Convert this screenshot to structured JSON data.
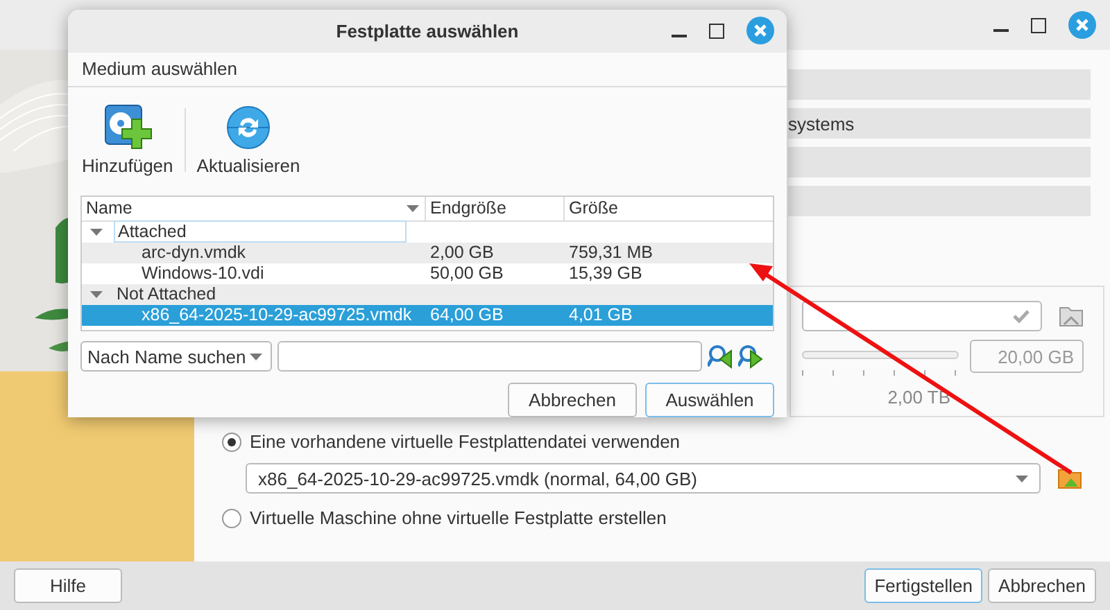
{
  "background_window": {
    "setting_rows": [
      {
        "label": "systems"
      }
    ],
    "disk_size": {
      "value": "20,00 GB",
      "max_label": "2,00 TB"
    },
    "options": [
      {
        "label": "Eine vorhandene virtuelle Festplattendatei verwenden",
        "selected": true,
        "kind": "radio"
      },
      {
        "label": "x86_64-2025-10-29-ac99725.vmdk (normal, 64,00 GB)",
        "kind": "combo"
      },
      {
        "label": "Virtuelle Maschine ohne virtuelle Festplatte erstellen",
        "selected": false,
        "kind": "radio"
      }
    ],
    "buttons": [
      {
        "label": "Hilfe",
        "default": false
      },
      {
        "label": "Fertigstellen",
        "default": true
      },
      {
        "label": "Abbrechen",
        "default": false
      }
    ]
  },
  "dialog": {
    "title": "Festplatte auswählen",
    "menu": "Medium auswählen",
    "toolbar": [
      {
        "label": "Hinzufügen",
        "kind": "add"
      },
      {
        "label": "Aktualisieren",
        "kind": "refresh"
      }
    ],
    "table": {
      "columns": [
        "Name",
        "Endgröße",
        "Größe"
      ],
      "groups": [
        {
          "label": "Attached",
          "expanded": true,
          "rows": [
            {
              "name": "arc-dyn.vmdk",
              "virtual_size": "2,00 GB",
              "size": "759,31 MB",
              "selected": false
            },
            {
              "name": "Windows-10.vdi",
              "virtual_size": "50,00 GB",
              "size": "15,39 GB",
              "selected": false
            }
          ]
        },
        {
          "label": "Not Attached",
          "expanded": true,
          "rows": [
            {
              "name": "x86_64-2025-10-29-ac99725.vmdk",
              "virtual_size": "64,00 GB",
              "size": "4,01 GB",
              "selected": true
            }
          ]
        }
      ]
    },
    "search_mode": "Nach Name suchen",
    "buttons": [
      {
        "label": "Abbrechen",
        "default": false
      },
      {
        "label": "Auswählen",
        "default": true
      }
    ]
  }
}
